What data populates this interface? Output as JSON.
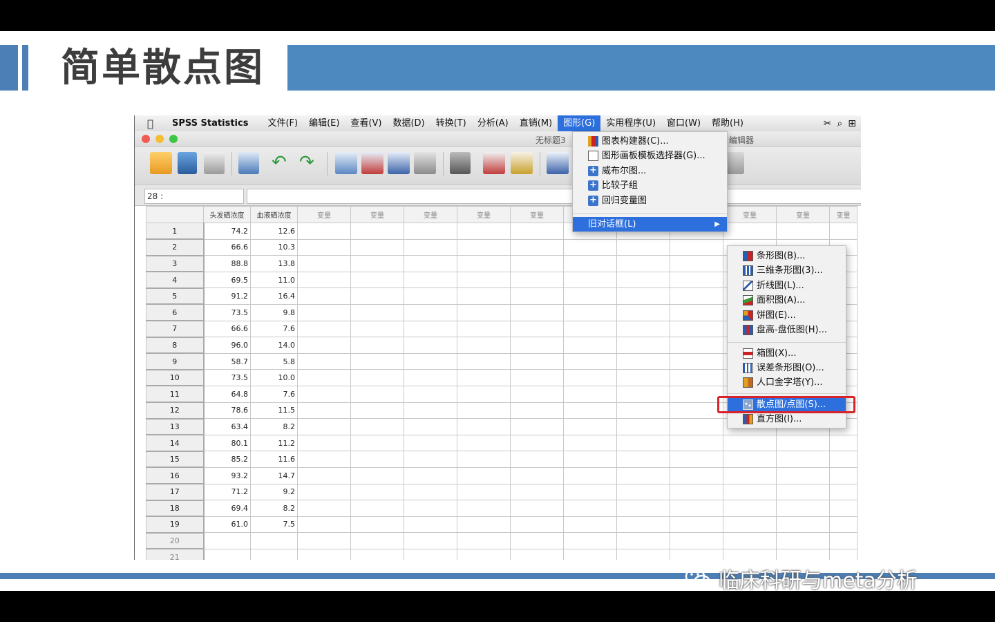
{
  "slide": {
    "title": "简单散点图",
    "watermark": "临床科研与meta分析"
  },
  "menubar": {
    "app_name": "SPSS Statistics",
    "items": [
      {
        "label": "文件(F)"
      },
      {
        "label": "编辑(E)"
      },
      {
        "label": "查看(V)"
      },
      {
        "label": "数据(D)"
      },
      {
        "label": "转换(T)"
      },
      {
        "label": "分析(A)"
      },
      {
        "label": "直销(M)"
      },
      {
        "label": "图形(G)"
      },
      {
        "label": "实用程序(U)"
      },
      {
        "label": "窗口(W)"
      },
      {
        "label": "帮助(H)"
      }
    ],
    "active_item": "图形(G)"
  },
  "window": {
    "title": "无标题3",
    "title_right": "编辑器",
    "cell_ref": "28 :"
  },
  "grid": {
    "columns": [
      "头发硒浓度",
      "血液硒浓度",
      "变量",
      "变量",
      "变量",
      "变量",
      "变量",
      "变量",
      "变量",
      "变量",
      "变量",
      "变量",
      "变量"
    ],
    "rows": [
      {
        "n": "1",
        "a": "74.2",
        "b": "12.6"
      },
      {
        "n": "2",
        "a": "66.6",
        "b": "10.3"
      },
      {
        "n": "3",
        "a": "88.8",
        "b": "13.8"
      },
      {
        "n": "4",
        "a": "69.5",
        "b": "11.0"
      },
      {
        "n": "5",
        "a": "91.2",
        "b": "16.4"
      },
      {
        "n": "6",
        "a": "73.5",
        "b": "9.8"
      },
      {
        "n": "7",
        "a": "66.6",
        "b": "7.6"
      },
      {
        "n": "8",
        "a": "96.0",
        "b": "14.0"
      },
      {
        "n": "9",
        "a": "58.7",
        "b": "5.8"
      },
      {
        "n": "10",
        "a": "73.5",
        "b": "10.0"
      },
      {
        "n": "11",
        "a": "64.8",
        "b": "7.6"
      },
      {
        "n": "12",
        "a": "78.6",
        "b": "11.5"
      },
      {
        "n": "13",
        "a": "63.4",
        "b": "8.2"
      },
      {
        "n": "14",
        "a": "80.1",
        "b": "11.2"
      },
      {
        "n": "15",
        "a": "85.2",
        "b": "11.6"
      },
      {
        "n": "16",
        "a": "93.2",
        "b": "14.7"
      },
      {
        "n": "17",
        "a": "71.2",
        "b": "9.2"
      },
      {
        "n": "18",
        "a": "69.4",
        "b": "8.2"
      },
      {
        "n": "19",
        "a": "61.0",
        "b": "7.5"
      },
      {
        "n": "20",
        "a": "",
        "b": ""
      },
      {
        "n": "21",
        "a": "",
        "b": ""
      }
    ]
  },
  "graphs_menu": {
    "items": [
      {
        "label": "图表构建器(C)...",
        "icon": "chart-builder-icon"
      },
      {
        "label": "图形画板模板选择器(G)...",
        "icon": "template-icon"
      },
      {
        "label": "威布尔图...",
        "icon": "plus-icon"
      },
      {
        "label": "比较子组",
        "icon": "plus-icon"
      },
      {
        "label": "回归变量图",
        "icon": "plus-icon"
      }
    ],
    "legacy": "旧对话框(L)"
  },
  "legacy_menu": {
    "items": [
      {
        "label": "条形图(B)...",
        "icon": "bar-chart-icon"
      },
      {
        "label": "三维条形图(3)...",
        "icon": "3d-bar-icon"
      },
      {
        "label": "折线图(L)...",
        "icon": "line-chart-icon"
      },
      {
        "label": "面积图(A)...",
        "icon": "area-chart-icon"
      },
      {
        "label": "饼图(E)...",
        "icon": "pie-chart-icon"
      },
      {
        "label": "盘高-盘低图(H)...",
        "icon": "high-low-icon"
      },
      {
        "label": "箱图(X)...",
        "icon": "boxplot-icon"
      },
      {
        "label": "误差条形图(O)...",
        "icon": "error-bar-icon"
      },
      {
        "label": "人口金字塔(Y)...",
        "icon": "pyramid-icon"
      },
      {
        "label": "散点图/点图(S)...",
        "icon": "scatter-icon"
      },
      {
        "label": "直方图(I)...",
        "icon": "histogram-icon"
      }
    ],
    "highlighted": "散点图/点图(S)..."
  },
  "colors": {
    "accent_blue": "#4b7fb6",
    "menu_highlight": "#2c6fdd",
    "annotation_red": "#d8232a"
  }
}
